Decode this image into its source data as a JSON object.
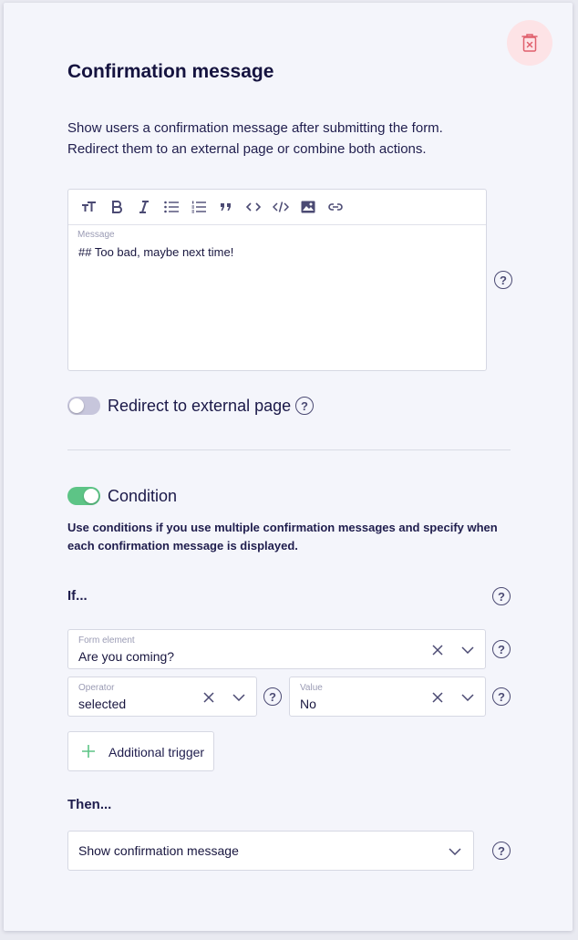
{
  "header": {
    "title": "Confirmation message",
    "description_lines": [
      "Show users a confirmation message after submitting the form.",
      "Redirect them to an external page or combine both actions."
    ]
  },
  "editor": {
    "label": "Message",
    "text": "## Too bad, maybe next time!",
    "toolbar": [
      "text-size-icon",
      "bold-icon",
      "italic-icon",
      "bullet-list-icon",
      "numbered-list-icon",
      "quote-icon",
      "code-icon",
      "code-block-icon",
      "image-icon",
      "link-icon"
    ]
  },
  "redirect": {
    "label": "Redirect to external page",
    "enabled": false
  },
  "condition": {
    "label": "Condition",
    "enabled": true,
    "description_lines": [
      "Use conditions if you use multiple confirmation messages and specify when",
      "each confirmation message is displayed."
    ],
    "if_label": "If...",
    "form_element": {
      "label": "Form element",
      "value": "Are you coming?"
    },
    "operator": {
      "label": "Operator",
      "value": "selected"
    },
    "value": {
      "label": "Value",
      "value": "No"
    },
    "add_trigger_label": "Additional trigger",
    "then_label": "Then...",
    "then_action": "Show confirmation message"
  },
  "help_glyph": "?",
  "colors": {
    "accent_green": "#5dc486",
    "delete_bg": "#fde3e6",
    "delete_icon": "#e0606d",
    "text_dark": "#15133f"
  }
}
